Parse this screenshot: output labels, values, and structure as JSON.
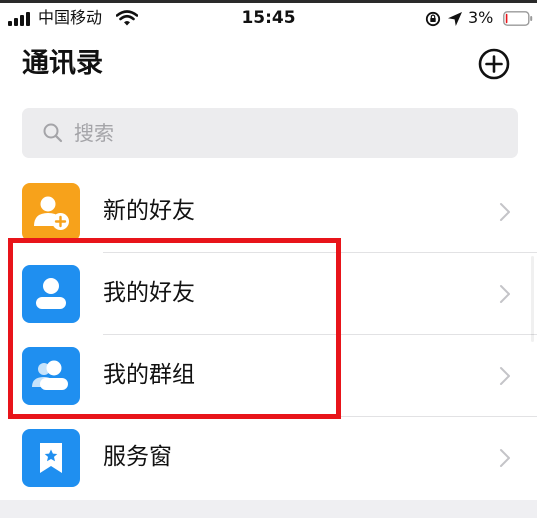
{
  "status_bar": {
    "carrier": "中国移动",
    "time": "15:45",
    "battery": "3%"
  },
  "header": {
    "title": "通讯录"
  },
  "search": {
    "placeholder": "搜索"
  },
  "list": {
    "items": [
      {
        "label": "新的好友",
        "icon": "add-friend-icon",
        "color": "#f7a21b"
      },
      {
        "label": "我的好友",
        "icon": "person-icon",
        "color": "#1f8ff0"
      },
      {
        "label": "我的群组",
        "icon": "group-icon",
        "color": "#1f8ff0"
      },
      {
        "label": "服务窗",
        "icon": "bookmark-star-icon",
        "color": "#1f8ff0"
      }
    ]
  },
  "colors": {
    "accent_orange": "#f7a21b",
    "accent_blue": "#1f8ff0",
    "highlight_red": "#e8141a",
    "search_bg": "#ececee"
  }
}
